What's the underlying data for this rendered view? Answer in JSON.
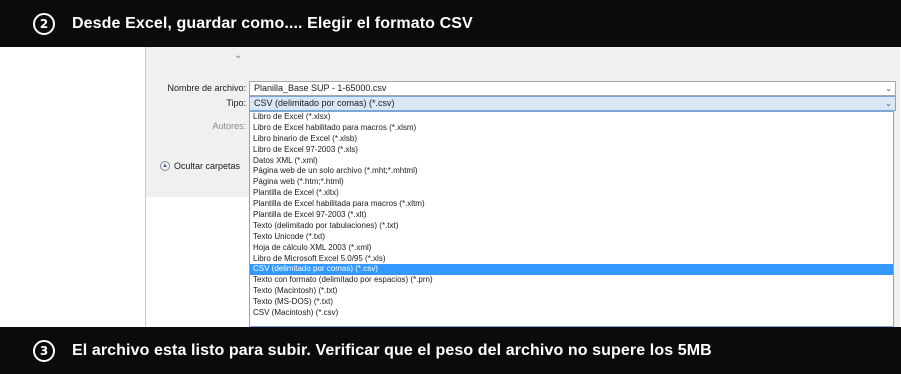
{
  "steps": [
    {
      "number": "2",
      "text": "Desde Excel, guardar como.... Elegir el formato CSV"
    },
    {
      "number": "3",
      "text": "El archivo esta listo para subir. Verificar que el peso del archivo no supere los 5MB"
    }
  ],
  "dialog": {
    "filename_label": "Nombre de archivo:",
    "filename_value": "Planilla_Base SUP - 1-65000.csv",
    "type_label": "Tipo:",
    "type_value": "CSV (delimitado por comas) (*.csv)",
    "authors_label": "Autores:",
    "hide_folders_label": "Ocultar carpetas",
    "type_options": [
      "Libro de Excel (*.xlsx)",
      "Libro de Excel habilitado para macros (*.xlsm)",
      "Libro binario de Excel (*.xlsb)",
      "Libro de Excel 97-2003 (*.xls)",
      "Datos XML (*.xml)",
      "Página web de un solo archivo (*.mht;*.mhtml)",
      "Página web (*.htm;*.html)",
      "Plantilla de Excel (*.xltx)",
      "Plantilla de Excel habilitada para macros (*.xltm)",
      "Plantilla de Excel 97-2003 (*.xlt)",
      "Texto (delimitado por tabulaciones) (*.txt)",
      "Texto Unicode (*.txt)",
      "Hoja de cálculo XML 2003 (*.xml)",
      "Libro de Microsoft Excel 5.0/95 (*.xls)",
      "CSV (delimitado por comas) (*.csv)",
      "Texto con formato (delimitado por espacios) (*.prn)",
      "Texto (Macintosh) (*.txt)",
      "Texto (MS-DOS) (*.txt)",
      "CSV (Macintosh) (*.csv)"
    ],
    "selected_index": 14
  },
  "colors": {
    "banner": "#0b0b0b",
    "selection": "#3399ff"
  }
}
